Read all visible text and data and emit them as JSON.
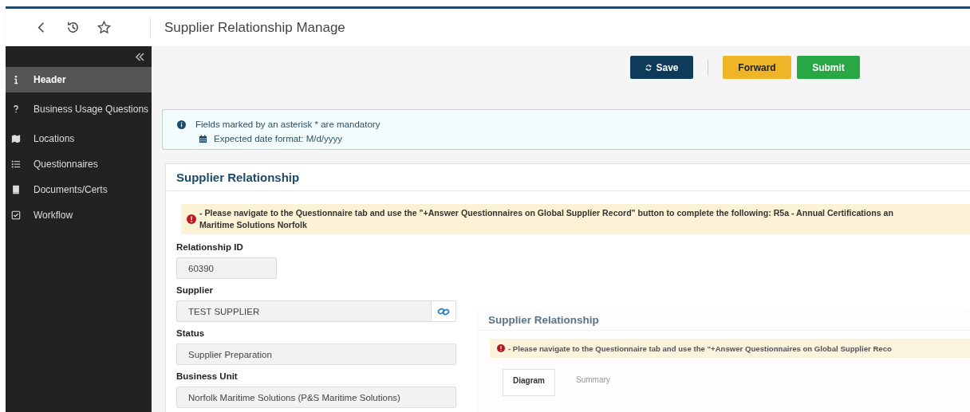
{
  "header": {
    "title": "Supplier Relationship Manage"
  },
  "sidebar": {
    "items": [
      {
        "label": "Header",
        "kind": "info",
        "selected": true
      },
      {
        "label": "Business Usage Questions",
        "kind": "question",
        "selected": false
      },
      {
        "label": "Locations",
        "kind": "map",
        "selected": false
      },
      {
        "label": "Questionnaires",
        "kind": "list",
        "selected": false
      },
      {
        "label": "Documents/Certs",
        "kind": "book",
        "selected": false
      },
      {
        "label": "Workflow",
        "kind": "check",
        "selected": false
      }
    ]
  },
  "toolbar": {
    "buttons": [
      {
        "label": "Save",
        "kind": "save"
      },
      {
        "label": "Forward",
        "kind": "forward"
      },
      {
        "label": "Submit",
        "kind": "submit"
      }
    ]
  },
  "notice": {
    "mandatory": "Fields marked by an asterisk * are mandatory",
    "date_format": "Expected date format: M/d/yyyy"
  },
  "card": {
    "title": "Supplier Relationship",
    "warning": [
      "- Please navigate to the Questionnaire tab and use the \"+Answer Questionnaires on Global Supplier Record\" button to complete the following: R5a - Annual Certifications an",
      "Maritime Solutions Norfolk"
    ],
    "fields": [
      {
        "label": "Relationship ID",
        "value": "60390",
        "kind": "short"
      },
      {
        "label": "Supplier",
        "value": "TEST SUPPLIER",
        "kind": "link"
      },
      {
        "label": "Status",
        "value": "Supplier Preparation",
        "kind": "wide"
      },
      {
        "label": "Business Unit",
        "value": "Norfolk Maritime Solutions (P&S Maritime Solutions)",
        "kind": "wide"
      }
    ]
  },
  "embedded_screenshot": {
    "title": "Supplier Relationship",
    "warning": "- Please navigate to the Questionnaire tab and use the \"+Answer Questionnaires on Global Supplier Reco",
    "tabs": [
      {
        "label": "Diagram",
        "selected": true
      },
      {
        "label": "Summary",
        "selected": false
      }
    ]
  }
}
